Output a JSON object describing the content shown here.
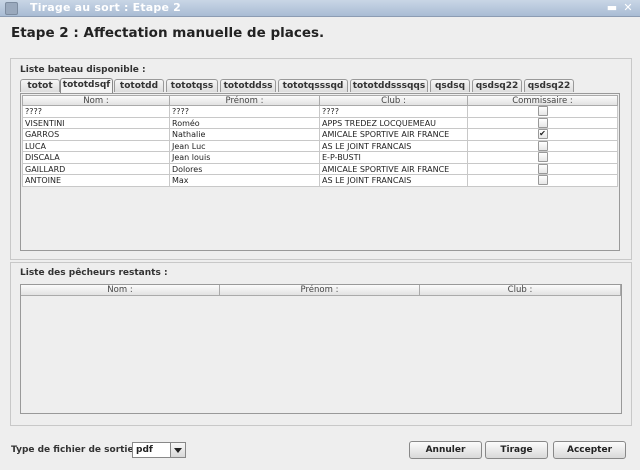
{
  "window": {
    "title": "Tirage au sort : Etape 2"
  },
  "heading": "Etape 2 : Affectation manuelle de places.",
  "boats_panel": {
    "label": "Liste bateau disponible :",
    "tabs": [
      "totot",
      "tototdsqf",
      "tototdd",
      "tototqss",
      "tototddss",
      "tototqsssqd",
      "tototddsssqqs",
      "qsdsq",
      "qsdsq22",
      "qsdsq22"
    ],
    "active_tab": 1,
    "columns": [
      "Nom :",
      "Prénom :",
      "Club :",
      "Commissaire :"
    ],
    "rows": [
      {
        "nom": "????",
        "prenom": "????",
        "club": "????",
        "commissaire": false
      },
      {
        "nom": "VISENTINI",
        "prenom": "Roméo",
        "club": "APPS TREDEZ LOCQUEMEAU",
        "commissaire": false
      },
      {
        "nom": "GARROS",
        "prenom": "Nathalie",
        "club": "AMICALE SPORTIVE AIR FRANCE",
        "commissaire": true
      },
      {
        "nom": "LUCA",
        "prenom": "Jean Luc",
        "club": "AS LE JOINT FRANCAIS",
        "commissaire": false
      },
      {
        "nom": "DISCALA",
        "prenom": "Jean louis",
        "club": "E-P-BUSTI",
        "commissaire": false
      },
      {
        "nom": "GAILLARD",
        "prenom": "Dolores",
        "club": "AMICALE SPORTIVE AIR FRANCE",
        "commissaire": false
      },
      {
        "nom": "ANTOINE",
        "prenom": "Max",
        "club": "AS LE JOINT FRANCAIS",
        "commissaire": false
      }
    ]
  },
  "remaining_panel": {
    "label": "Liste des pêcheurs restants :",
    "columns": [
      "Nom :",
      "Prénom :",
      "Club :"
    ]
  },
  "output": {
    "label": "Type de fichier de sortie :",
    "selected": "pdf"
  },
  "buttons": {
    "annuler": "Annuler",
    "tirage": "Tirage",
    "accepter": "Accepter"
  }
}
